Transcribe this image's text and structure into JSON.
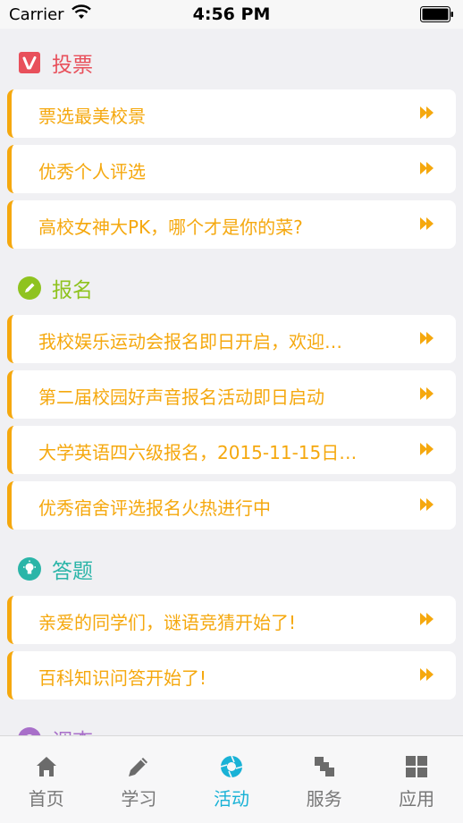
{
  "status_bar": {
    "carrier": "Carrier",
    "time": "4:56 PM"
  },
  "sections": [
    {
      "title": "投票",
      "color": "#e8505b",
      "icon": "vote-icon",
      "items": [
        "票选最美校景",
        "优秀个人评选",
        "高校女神大PK，哪个才是你的菜?"
      ]
    },
    {
      "title": "报名",
      "color": "#8fc31f",
      "icon": "pencil-icon",
      "items": [
        "我校娱乐运动会报名即日开启，欢迎…",
        "第二届校园好声音报名活动即日启动",
        "大学英语四六级报名，2015-11-15日…",
        "优秀宿舍评选报名火热进行中"
      ]
    },
    {
      "title": "答题",
      "color": "#2bb5a8",
      "icon": "lightbulb-icon",
      "items": [
        "亲爱的同学们，谜语竞猜开始了!",
        "百科知识问答开始了!"
      ]
    },
    {
      "title": "调查",
      "color": "#a86fc9",
      "icon": "survey-icon",
      "items": []
    }
  ],
  "tab_bar": {
    "tabs": [
      {
        "label": "首页",
        "icon": "home-icon"
      },
      {
        "label": "学习",
        "icon": "pencil-icon"
      },
      {
        "label": "活动",
        "icon": "aperture-icon"
      },
      {
        "label": "服务",
        "icon": "service-icon"
      },
      {
        "label": "应用",
        "icon": "grid-icon"
      }
    ],
    "active": "活动",
    "active_color": "#19b2d6",
    "inactive_color": "#777777"
  },
  "item_accent_color": "#f5a80e"
}
